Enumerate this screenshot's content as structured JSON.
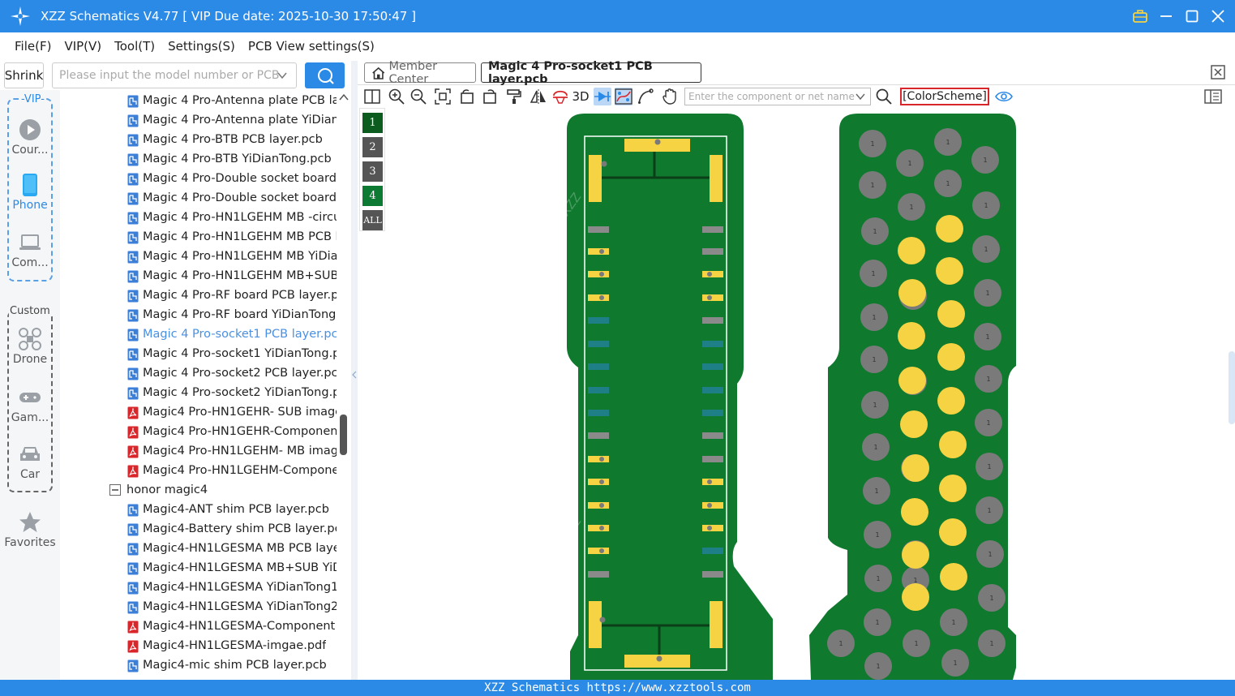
{
  "window": {
    "title": "XZZ Schematics V4.77 [ VIP Due date: 2025-10-30 17:50:47 ]"
  },
  "menu": [
    "File(F)",
    "VIP(V)",
    "Tool(T)",
    "Settings(S)",
    "PCB View settings(S)"
  ],
  "search": {
    "shrink_label": "Shrink",
    "placeholder": "Please input the model number or PCB"
  },
  "nav": {
    "vip_label": "-VIP-",
    "custom_label": "Custom",
    "items": [
      {
        "label": "Cour..."
      },
      {
        "label": "Phone"
      },
      {
        "label": "Com..."
      },
      {
        "label": "Drone"
      },
      {
        "label": "Gam..."
      },
      {
        "label": "Car"
      },
      {
        "label": "Favorites"
      }
    ]
  },
  "tree": {
    "items": [
      {
        "label": "Magic 4 Pro-Antenna plate PCB la",
        "type": "pcb"
      },
      {
        "label": "Magic 4 Pro-Antenna plate YiDian",
        "type": "pcb"
      },
      {
        "label": "Magic 4 Pro-BTB PCB layer.pcb",
        "type": "pcb"
      },
      {
        "label": "Magic 4 Pro-BTB YiDianTong.pcb",
        "type": "pcb"
      },
      {
        "label": "Magic 4 Pro-Double socket board",
        "type": "pcb"
      },
      {
        "label": "Magic 4 Pro-Double socket board",
        "type": "pcb"
      },
      {
        "label": "Magic 4 Pro-HN1LGEHM MB -circu",
        "type": "pcb"
      },
      {
        "label": "Magic 4 Pro-HN1LGEHM MB PCB l",
        "type": "pcb"
      },
      {
        "label": "Magic 4 Pro-HN1LGEHM MB YiDia",
        "type": "pcb"
      },
      {
        "label": "Magic 4 Pro-HN1LGEHM MB+SUB",
        "type": "pcb"
      },
      {
        "label": "Magic 4 Pro-RF board PCB layer.pc",
        "type": "pcb"
      },
      {
        "label": "Magic 4 Pro-RF board YiDianTong",
        "type": "pcb"
      },
      {
        "label": "Magic 4 Pro-socket1 PCB layer.pcb",
        "type": "pcb",
        "selected": true
      },
      {
        "label": "Magic 4 Pro-socket1 YiDianTong.p",
        "type": "pcb"
      },
      {
        "label": "Magic 4 Pro-socket2 PCB layer.pcb",
        "type": "pcb"
      },
      {
        "label": "Magic 4 Pro-socket2 YiDianTong.p",
        "type": "pcb"
      },
      {
        "label": "Magic4 Pro-HN1GEHR- SUB image",
        "type": "pdf"
      },
      {
        "label": "Magic4 Pro-HN1GEHR-Componen",
        "type": "pdf"
      },
      {
        "label": "Magic4 Pro-HN1LGEHM- MB imag",
        "type": "pdf"
      },
      {
        "label": "Magic4 Pro-HN1LGEHM-Compone",
        "type": "pdf"
      },
      {
        "label": "honor magic4",
        "type": "folder"
      },
      {
        "label": "Magic4-ANT shim PCB layer.pcb",
        "type": "pcb"
      },
      {
        "label": "Magic4-Battery shim PCB layer.pcb",
        "type": "pcb"
      },
      {
        "label": "Magic4-HN1LGESMA MB PCB laye",
        "type": "pcb"
      },
      {
        "label": "Magic4-HN1LGESMA MB+SUB YiD",
        "type": "pcb"
      },
      {
        "label": "Magic4-HN1LGESMA YiDianTong1",
        "type": "pcb"
      },
      {
        "label": "Magic4-HN1LGESMA YiDianTong2",
        "type": "pcb"
      },
      {
        "label": "Magic4-HN1LGESMA-Component",
        "type": "pdf"
      },
      {
        "label": "Magic4-HN1LGESMA-imgae.pdf",
        "type": "pdf"
      },
      {
        "label": "Magic4-mic shim PCB layer.pcb",
        "type": "pcb"
      }
    ]
  },
  "tabs": {
    "member": "Member Center",
    "active": "Magic 4 Pro-socket1 PCB layer.pcb"
  },
  "toolbar": {
    "three_d": "3D",
    "component_placeholder": "Enter the component or net name",
    "color_scheme": "[ColorScheme]"
  },
  "layers": [
    "1",
    "2",
    "3",
    "4",
    "ALL"
  ],
  "pcb": {
    "watermark": "XZZ@XZZ",
    "pad_label": "1",
    "board_color": "#0f7a2e",
    "pad_color": "#f5d342",
    "via_color": "#7a7a7a"
  },
  "status": {
    "text": "XZZ Schematics https://www.xzztools.com"
  },
  "colors": {
    "accent": "#2b8ae6",
    "selected_text": "#4a90e2",
    "pcb_icon": "#3b7fd9",
    "pdf_icon": "#d9262b"
  }
}
